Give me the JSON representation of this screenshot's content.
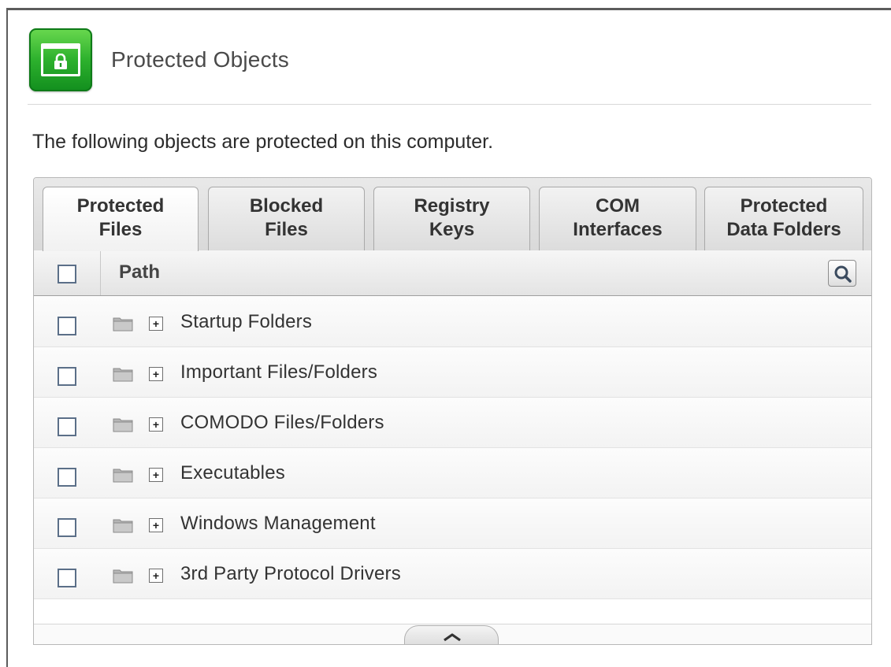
{
  "header": {
    "title": "Protected Objects",
    "icon": "lock-window-icon"
  },
  "description": "The following objects are protected on this computer.",
  "tabs": [
    {
      "line1": "Protected",
      "line2": "Files",
      "active": true
    },
    {
      "line1": "Blocked",
      "line2": "Files",
      "active": false
    },
    {
      "line1": "Registry",
      "line2": "Keys",
      "active": false
    },
    {
      "line1": "COM",
      "line2": "Interfaces",
      "active": false
    },
    {
      "line1": "Protected",
      "line2": "Data Folders",
      "active": false
    }
  ],
  "table": {
    "column_header": "Path",
    "rows": [
      {
        "label": "Startup Folders",
        "expand": "+"
      },
      {
        "label": "Important Files/Folders",
        "expand": "+"
      },
      {
        "label": "COMODO Files/Folders",
        "expand": "+"
      },
      {
        "label": "Executables",
        "expand": "+"
      },
      {
        "label": "Windows Management",
        "expand": "+"
      },
      {
        "label": "3rd Party Protocol Drivers",
        "expand": "+"
      }
    ]
  },
  "colors": {
    "icon_green": "#2db12d",
    "checkbox_border": "#5b6f88"
  }
}
